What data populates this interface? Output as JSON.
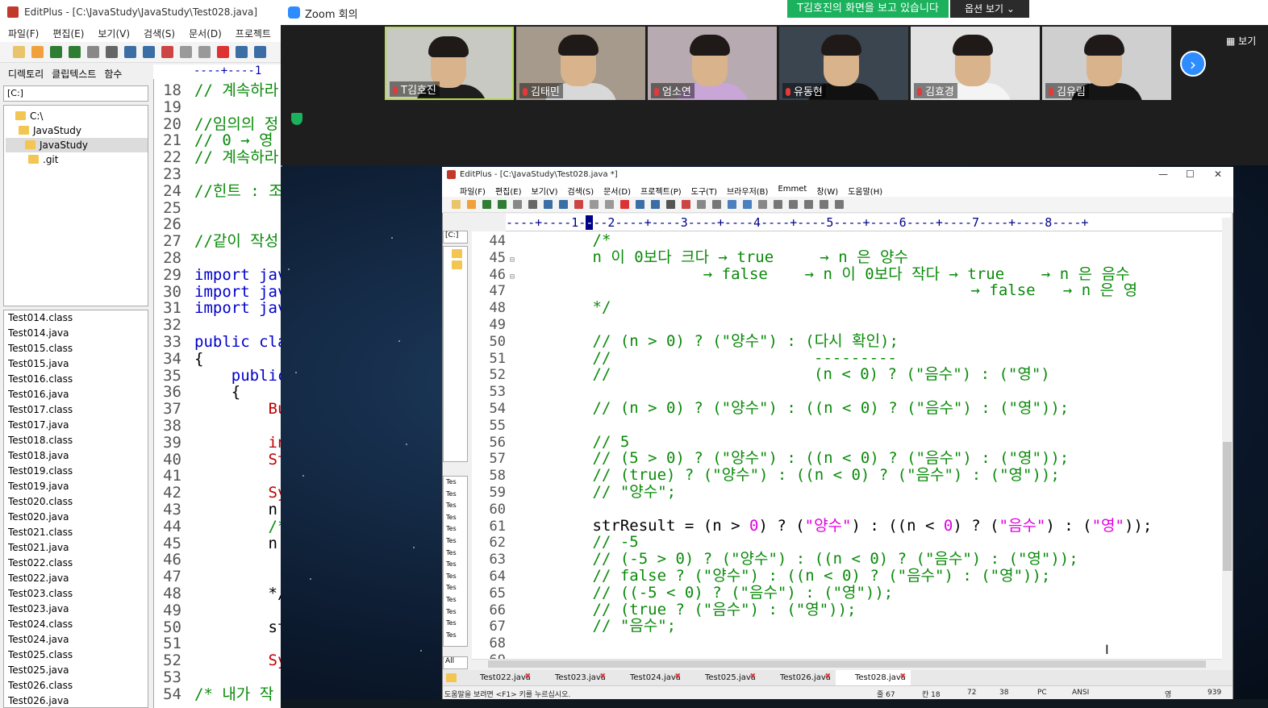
{
  "bg_editplus": {
    "title": "EditPlus - [C:\\JavaStudy\\JavaStudy\\Test028.java]",
    "menu": [
      "파일(F)",
      "편집(E)",
      "보기(V)",
      "검색(S)",
      "문서(D)",
      "프로젝트"
    ],
    "sidebar_tabs": [
      "디렉토리",
      "클립텍스트",
      "함수"
    ],
    "drive": "[C:]",
    "tree": [
      "C:\\",
      "JavaStudy",
      "JavaStudy",
      ".git"
    ],
    "files": [
      "Test014.class",
      "Test014.java",
      "Test015.class",
      "Test015.java",
      "Test016.class",
      "Test016.java",
      "Test017.class",
      "Test017.java",
      "Test018.class",
      "Test018.java",
      "Test019.class",
      "Test019.java",
      "Test020.class",
      "Test020.java",
      "Test021.class",
      "Test021.java",
      "Test022.class",
      "Test022.java",
      "Test023.class",
      "Test023.java",
      "Test024.class",
      "Test024.java",
      "Test025.class",
      "Test025.java",
      "Test026.class",
      "Test026.java"
    ],
    "ruler": "----+----1",
    "lines": [
      {
        "n": "18",
        "t": "// 계속하라"
      },
      {
        "n": "19",
        "t": ""
      },
      {
        "n": "20",
        "t": "//임의의 정"
      },
      {
        "n": "21",
        "t": "// 0 → 영"
      },
      {
        "n": "22",
        "t": "// 계속하라"
      },
      {
        "n": "23",
        "t": ""
      },
      {
        "n": "24",
        "t": "//힌트 : 조"
      },
      {
        "n": "25",
        "t": ""
      },
      {
        "n": "26",
        "t": ""
      },
      {
        "n": "27",
        "t": "//같이 작성"
      },
      {
        "n": "28",
        "t": ""
      },
      {
        "n": "29",
        "t": "import jav"
      },
      {
        "n": "30",
        "t": "import jav"
      },
      {
        "n": "31",
        "t": "import jav"
      },
      {
        "n": "32",
        "t": ""
      },
      {
        "n": "33",
        "t": "public cla"
      },
      {
        "n": "34",
        "t": "{"
      },
      {
        "n": "35",
        "t": "    public"
      },
      {
        "n": "36",
        "t": "    {"
      },
      {
        "n": "37",
        "t": "        Bu"
      },
      {
        "n": "38",
        "t": ""
      },
      {
        "n": "39",
        "t": "        in"
      },
      {
        "n": "40",
        "t": "        St"
      },
      {
        "n": "41",
        "t": ""
      },
      {
        "n": "42",
        "t": "        Sy"
      },
      {
        "n": "43",
        "t": "        n "
      },
      {
        "n": "44",
        "t": "        /*"
      },
      {
        "n": "45",
        "t": "        n("
      },
      {
        "n": "46",
        "t": ""
      },
      {
        "n": "47",
        "t": ""
      },
      {
        "n": "48",
        "t": "        */"
      },
      {
        "n": "49",
        "t": ""
      },
      {
        "n": "50",
        "t": "        st"
      },
      {
        "n": "51",
        "t": ""
      },
      {
        "n": "52",
        "t": "        Sy"
      },
      {
        "n": "53",
        "t": ""
      },
      {
        "n": "54",
        "t": "/* 내가 작"
      }
    ]
  },
  "zoom": {
    "title": "Zoom 회의",
    "share_banner": "T김호진의 화면을 보고 있습니다",
    "view_options": "옵션 보기 ⌄",
    "gallery": "보기",
    "participants": [
      {
        "name": "T김호진",
        "bg": "#c9c9c4",
        "shirt": "#1e1e1e"
      },
      {
        "name": "김태민",
        "bg": "#a59a8c",
        "shirt": "#d8d8d8"
      },
      {
        "name": "엄소연",
        "bg": "#b7aab0",
        "shirt": "#c9a6d8"
      },
      {
        "name": "유동현",
        "bg": "#3b4550",
        "shirt": "#111111"
      },
      {
        "name": "김효경",
        "bg": "#e2e2e2",
        "shirt": "#f4f4f4"
      },
      {
        "name": "김유림",
        "bg": "#cfcfcf",
        "shirt": "#151515"
      }
    ]
  },
  "editplus": {
    "title": "EditPlus - [C:\\JavaStudy\\Test028.java *]",
    "menu": [
      "파일(F)",
      "편집(E)",
      "보기(V)",
      "검색(S)",
      "문서(D)",
      "프로젝트(P)",
      "도구(T)",
      "브라우저(B)",
      "Emmet",
      "창(W)",
      "도움말(H)"
    ],
    "drive": "[C:]",
    "all_label": "All",
    "ruler": "----+----1-",
    "ruler_cur": "-",
    "ruler_rest": "--2----+----3----+----4----+----5----+----6----+----7----+----8----+",
    "side_files": [
      "Tes",
      "Tes",
      "Tes",
      "Tes",
      "Tes",
      "Tes",
      "Tes",
      "Tes",
      "Tes",
      "Tes",
      "Tes",
      "Tes",
      "Tes",
      "Tes"
    ],
    "doc_tabs": [
      "Test022.java",
      "Test023.java",
      "Test024.java",
      "Test025.java",
      "Test026.java",
      "Test028.java"
    ],
    "status": {
      "help": "도움말을 보려면 <F1> 키를 누르십시오.",
      "line": "줄 67",
      "col": "칸 18",
      "c1": "72",
      "c2": "38",
      "mode": "PC",
      "enc": "ANSI",
      "ime": "영",
      "size": "939"
    },
    "code": [
      {
        "n": "44",
        "f": "",
        "parts": [
          [
            "cmt",
            "        /*"
          ]
        ]
      },
      {
        "n": "45",
        "f": "⊟",
        "parts": [
          [
            "cmt",
            "        n 이 0보다 크다 → true     → n 은 양수"
          ]
        ]
      },
      {
        "n": "46",
        "f": "⊟",
        "parts": [
          [
            "cmt",
            "                    → false    → n 이 0보다 작다 → true    → n 은 음수"
          ]
        ]
      },
      {
        "n": "47",
        "f": "",
        "parts": [
          [
            "cmt",
            "                                                 → false   → n 은 영"
          ]
        ]
      },
      {
        "n": "48",
        "f": "",
        "parts": [
          [
            "cmt",
            "        */"
          ]
        ]
      },
      {
        "n": "49",
        "f": "",
        "parts": [
          [
            "cmt",
            ""
          ]
        ]
      },
      {
        "n": "50",
        "f": "",
        "parts": [
          [
            "cmt",
            "        // (n > 0) ? (\"양수\") : (다시 확인);"
          ]
        ]
      },
      {
        "n": "51",
        "f": "",
        "parts": [
          [
            "cmt",
            "        //                      ---------"
          ]
        ]
      },
      {
        "n": "52",
        "f": "",
        "parts": [
          [
            "cmt",
            "        //                      (n < 0) ? (\"음수\") : (\"영\")"
          ]
        ]
      },
      {
        "n": "53",
        "f": "",
        "parts": [
          [
            "cmt",
            ""
          ]
        ]
      },
      {
        "n": "54",
        "f": "",
        "parts": [
          [
            "cmt",
            "        // (n > 0) ? (\"양수\") : ((n < 0) ? (\"음수\") : (\"영\"));"
          ]
        ]
      },
      {
        "n": "55",
        "f": "",
        "parts": [
          [
            "cmt",
            ""
          ]
        ]
      },
      {
        "n": "56",
        "f": "",
        "parts": [
          [
            "cmt",
            "        // 5"
          ]
        ]
      },
      {
        "n": "57",
        "f": "",
        "parts": [
          [
            "cmt",
            "        // (5 > 0) ? (\"양수\") : ((n < 0) ? (\"음수\") : (\"영\"));"
          ]
        ]
      },
      {
        "n": "58",
        "f": "",
        "parts": [
          [
            "cmt",
            "        // (true) ? (\"양수\") : ((n < 0) ? (\"음수\") : (\"영\"));"
          ]
        ]
      },
      {
        "n": "59",
        "f": "",
        "parts": [
          [
            "cmt",
            "        // \"양수\";"
          ]
        ]
      },
      {
        "n": "60",
        "f": "",
        "parts": [
          [
            "cmt",
            ""
          ]
        ]
      },
      {
        "n": "61",
        "f": "",
        "parts": [
          [
            "kw",
            "        strResult = (n > "
          ],
          [
            "num",
            "0"
          ],
          [
            "kw",
            ") ? ("
          ],
          [
            "str",
            "\"양수\""
          ],
          [
            "kw",
            ") : ((n < "
          ],
          [
            "num",
            "0"
          ],
          [
            "kw",
            ") ? ("
          ],
          [
            "str",
            "\"음수\""
          ],
          [
            "kw",
            ") : ("
          ],
          [
            "str",
            "\"영\""
          ],
          [
            "kw",
            "));"
          ]
        ]
      },
      {
        "n": "62",
        "f": "",
        "parts": [
          [
            "cmt",
            "        // -5"
          ]
        ]
      },
      {
        "n": "63",
        "f": "",
        "parts": [
          [
            "cmt",
            "        // (-5 > 0) ? (\"양수\") : ((n < 0) ? (\"음수\") : (\"영\"));"
          ]
        ]
      },
      {
        "n": "64",
        "f": "",
        "parts": [
          [
            "cmt",
            "        // false ? (\"양수\") : ((n < 0) ? (\"음수\") : (\"영\"));"
          ]
        ]
      },
      {
        "n": "65",
        "f": "",
        "parts": [
          [
            "cmt",
            "        // ((-5 < 0) ? (\"음수\") : (\"영\"));"
          ]
        ]
      },
      {
        "n": "66",
        "f": "",
        "parts": [
          [
            "cmt",
            "        // (true ? (\"음수\") : (\"영\"));"
          ]
        ]
      },
      {
        "n": "67",
        "f": "",
        "parts": [
          [
            "cmt",
            "        // \"음수\";"
          ]
        ]
      },
      {
        "n": "68",
        "f": "",
        "parts": [
          [
            "cmt",
            ""
          ]
        ]
      },
      {
        "n": "69",
        "f": "",
        "parts": [
          [
            "cmt",
            ""
          ]
        ]
      }
    ]
  },
  "colors": {
    "zoom_blue": "#2d8cff",
    "share_green": "#1bb15d",
    "comment_green": "#0a8a0a",
    "string_magenta": "#e000e0"
  }
}
